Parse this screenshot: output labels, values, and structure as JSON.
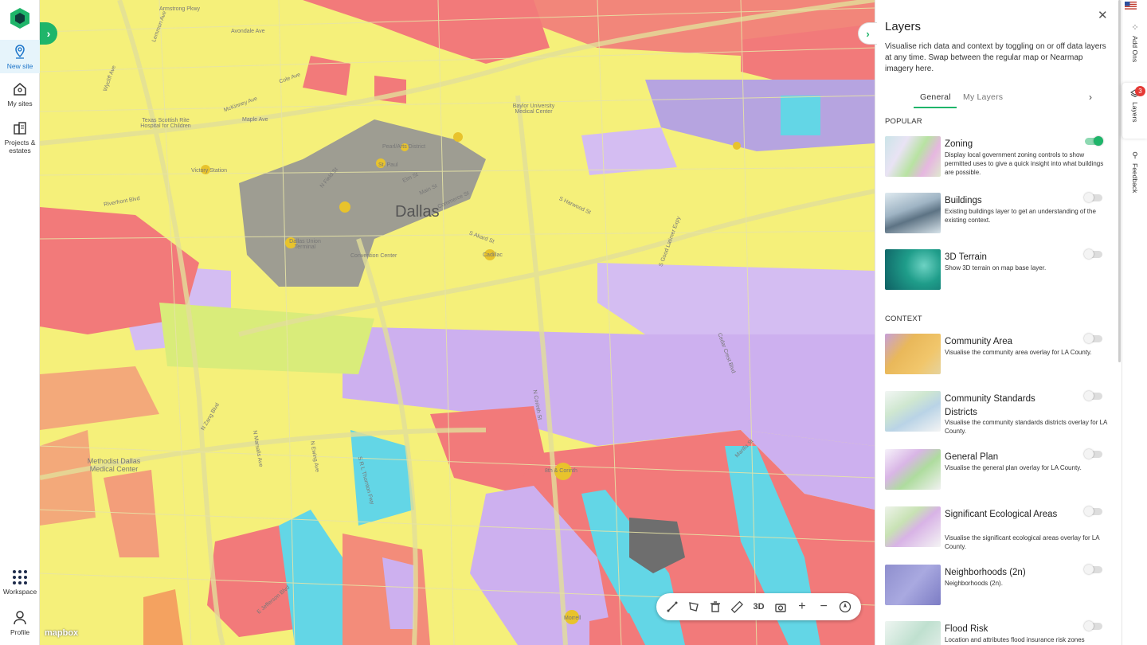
{
  "nav": {
    "items": [
      {
        "label": "New site"
      },
      {
        "label": "My sites"
      },
      {
        "label": "Projects &\nestates"
      },
      {
        "label": "Workspace"
      },
      {
        "label": "Profile"
      }
    ]
  },
  "map": {
    "city_label": "Dallas",
    "attribution": "mapbox",
    "labels": [
      "Armstrong Pkwy",
      "Avondale Ave",
      "Lemmon Ave",
      "Cole Ave",
      "McKinney Ave",
      "Maple Ave",
      "Wycliff Ave",
      "Texas Scottish Rite Hospital for Children",
      "Baylor University Medical Center",
      "Victory Station",
      "Pearl/Arts District",
      "St. Paul",
      "Dallas Union Terminal",
      "Convention Center",
      "N Field St",
      "S Akard St",
      "S Harwood St",
      "Cadillac",
      "S Good Latimer Expy",
      "Methodist Dallas Medical Center",
      "8th & Corinth",
      "N Corinth St",
      "Cedar Crest Blvd",
      "N Zang Blvd",
      "N Marsalis Ave",
      "N Ewing Ave",
      "S R L Thornton Fwy",
      "E Jefferson Blvd",
      "Morrell",
      "Riverfront Blvd",
      "Elm St",
      "Main St",
      "Commerce St",
      "Marilla St"
    ]
  },
  "toolbar": {
    "buttons": [
      {
        "icon": "measure-line-icon"
      },
      {
        "icon": "draw-polygon-icon"
      },
      {
        "icon": "trash-icon"
      },
      {
        "icon": "ruler-icon"
      },
      {
        "label": "3D"
      },
      {
        "icon": "camera-icon"
      },
      {
        "icon": "zoom-in-icon"
      },
      {
        "icon": "zoom-out-icon"
      },
      {
        "icon": "compass-icon"
      }
    ]
  },
  "panel": {
    "title": "Layers",
    "description": "Visualise rich data and context by toggling on or off data layers at any time. Swap between the regular map or Nearmap imagery here.",
    "tabs": [
      "General",
      "My Layers"
    ],
    "sections": {
      "popular": "POPULAR",
      "context": "CONTEXT"
    },
    "layers": [
      {
        "name": "Zoning",
        "desc": "Display local government zoning controls to show permitted uses to give a quick insight into what buildings are possible.",
        "on": true
      },
      {
        "name": "Buildings",
        "desc": "Existing buildings layer to get an understanding of the existing context.",
        "on": false
      },
      {
        "name": "3D Terrain",
        "desc": "Show 3D terrain on map base layer.",
        "on": false
      },
      {
        "name": "Community Area",
        "desc": "Visualise the community area overlay for LA County.",
        "on": false
      },
      {
        "name": "Community Standards Districts",
        "desc": "Visualise the community standards districts overlay for LA County.",
        "on": false
      },
      {
        "name": "General Plan",
        "desc": "Visualise the general plan overlay for LA County.",
        "on": false
      },
      {
        "name": "Significant Ecological Areas",
        "desc": "Visualise the significant ecological areas overlay for LA County.",
        "on": false
      },
      {
        "name": "Neighborhoods (2n)",
        "desc": "Neighborhoods (2n).",
        "on": false
      },
      {
        "name": "Flood Risk",
        "desc": "Location and attributes flood insurance risk zones",
        "on": false
      }
    ]
  },
  "rail": {
    "addons": "Add Ons",
    "layers": "Layers",
    "layers_badge": "3",
    "feedback": "Feedback"
  },
  "colors": {
    "accent": "#1fb56a",
    "zone_yellow": "#f5f07a",
    "zone_red": "#f27a7a",
    "zone_purple": "#cdb0ef",
    "zone_cyan": "#63d6e6",
    "zone_gray": "#8e8e96"
  }
}
